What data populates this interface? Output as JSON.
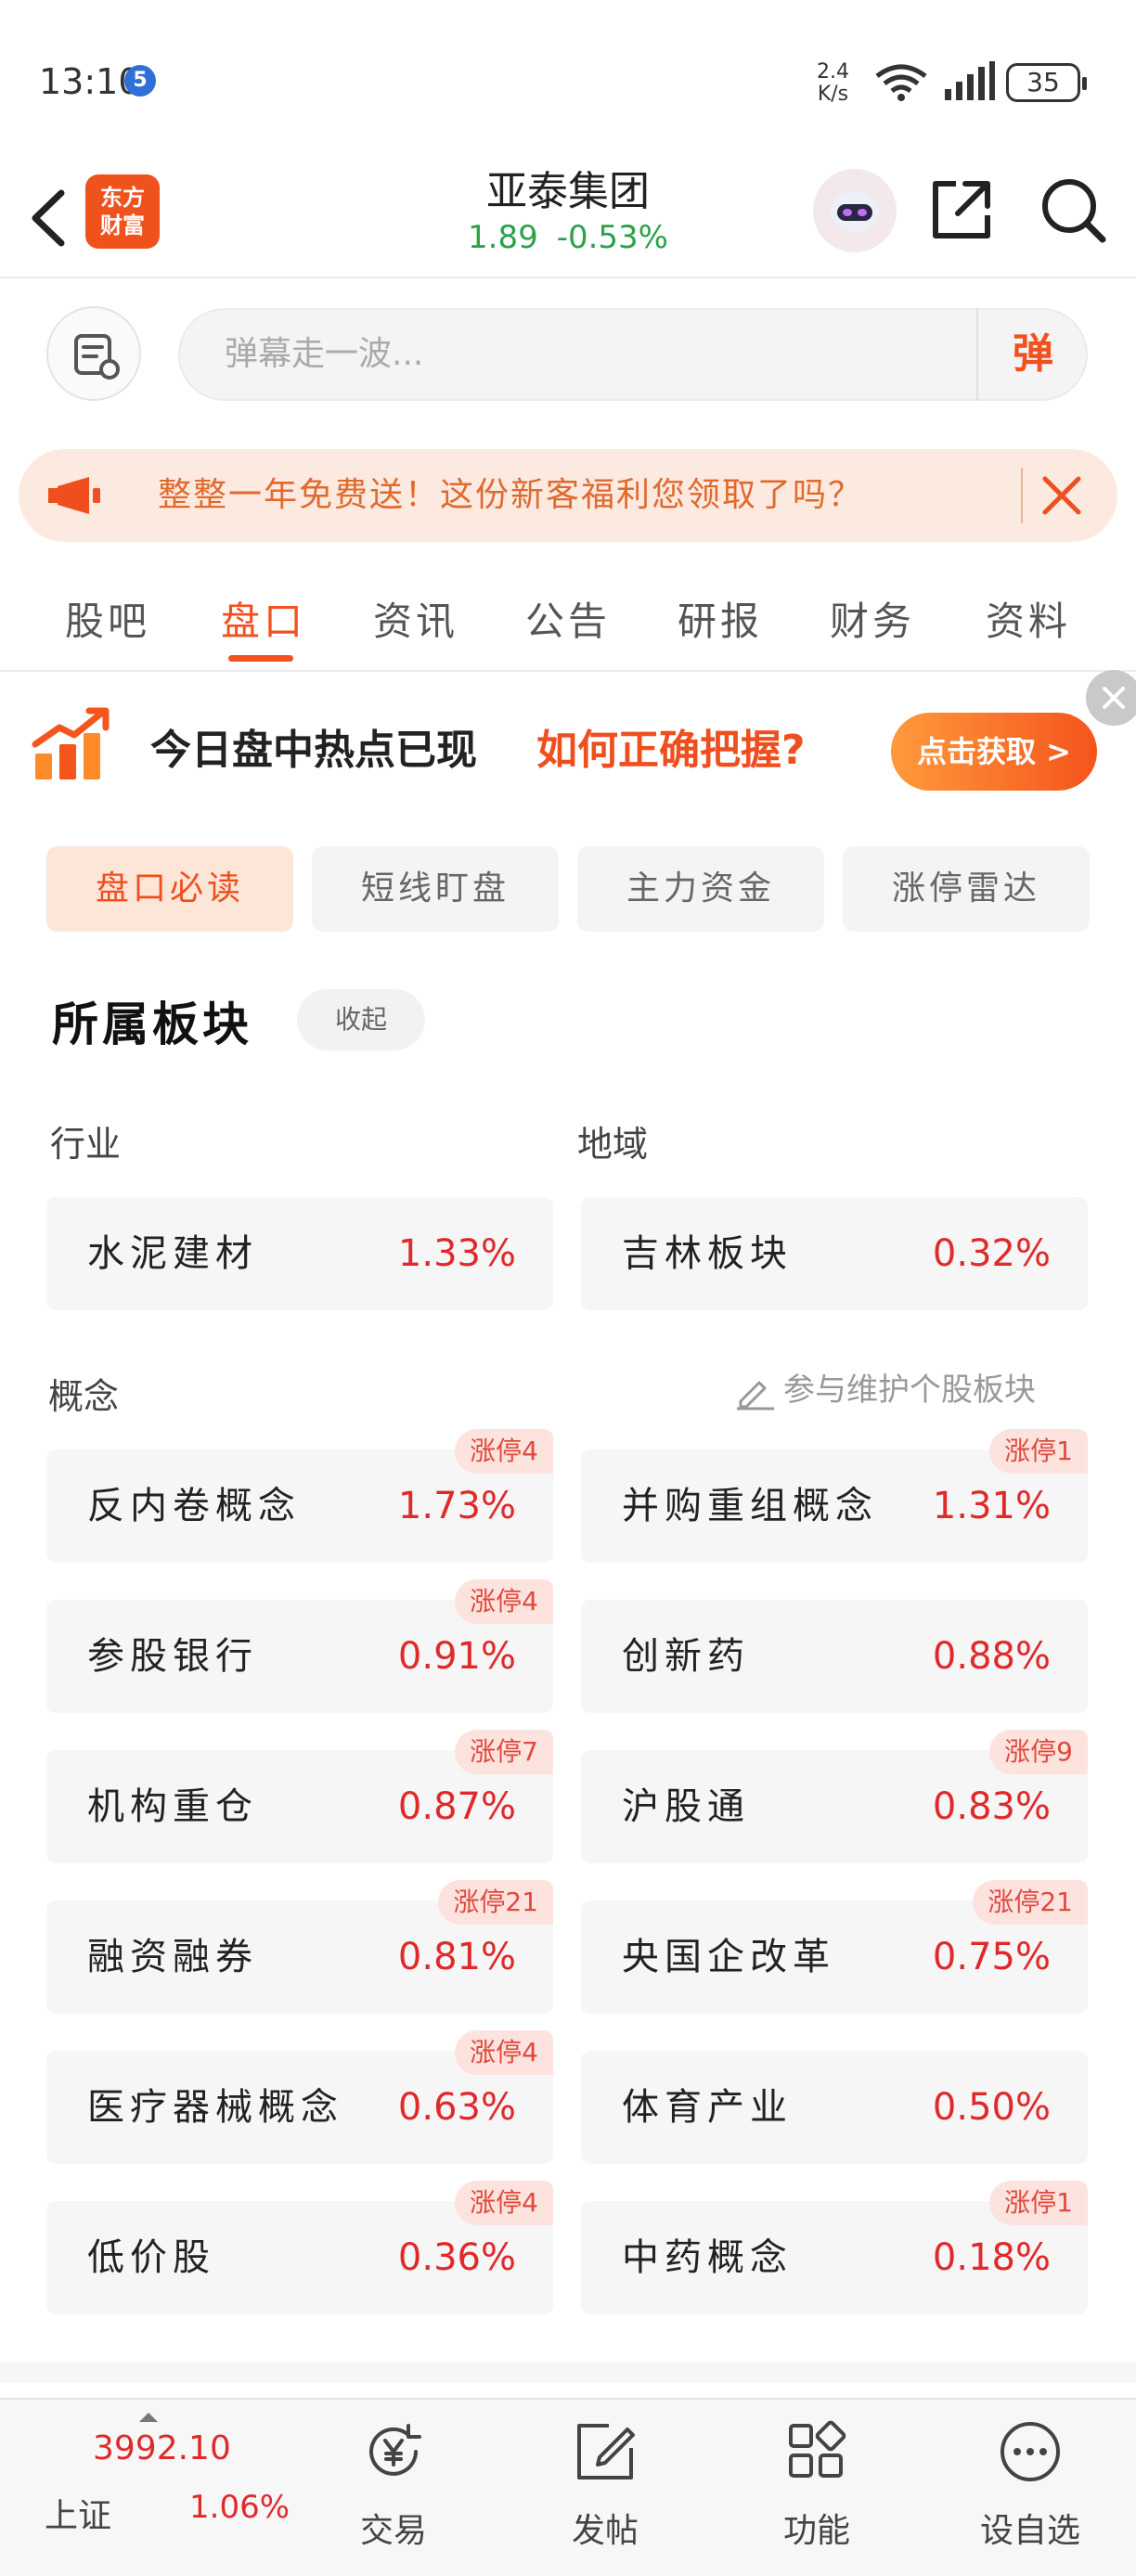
{
  "status_bar": {
    "time": "13:10",
    "notif": "5",
    "speed_value": "2.4",
    "speed_unit": "K/s",
    "battery": "35"
  },
  "header": {
    "logo_line1": "东方",
    "logo_line2": "财富",
    "stock_name": "亚泰集团",
    "price": "1.89",
    "change": "-0.53%"
  },
  "danmu": {
    "placeholder": "弹幕走一波...",
    "send_label": "弹"
  },
  "promo": {
    "text": "整整一年免费送！这份新客福利您领取了吗？"
  },
  "tabs": [
    "股吧",
    "盘口",
    "资讯",
    "公告",
    "研报",
    "财务",
    "资料"
  ],
  "active_tab": "盘口",
  "ad": {
    "text_black": "今日盘中热点已现",
    "text_orange": "如何正确把握?",
    "button": "点击获取 >"
  },
  "subtabs": [
    "盘口必读",
    "短线盯盘",
    "主力资金",
    "涨停雷达"
  ],
  "section": {
    "title": "所属板块",
    "collapse": "收起",
    "industry_label": "行业",
    "region_label": "地域",
    "concept_label": "概念",
    "maintain_link": "参与维护个股板块"
  },
  "industry": {
    "name": "水泥建材",
    "pct": "1.33%"
  },
  "region": {
    "name": "吉林板块",
    "pct": "0.32%"
  },
  "concepts": [
    {
      "name": "反内卷概念",
      "pct": "1.73%",
      "badge": "涨停4"
    },
    {
      "name": "并购重组概念",
      "pct": "1.31%",
      "badge": "涨停1"
    },
    {
      "name": "参股银行",
      "pct": "0.91%",
      "badge": "涨停4"
    },
    {
      "name": "创新药",
      "pct": "0.88%",
      "badge": ""
    },
    {
      "name": "机构重仓",
      "pct": "0.87%",
      "badge": "涨停7"
    },
    {
      "name": "沪股通",
      "pct": "0.83%",
      "badge": "涨停9"
    },
    {
      "name": "融资融券",
      "pct": "0.81%",
      "badge": "涨停21"
    },
    {
      "name": "央国企改革",
      "pct": "0.75%",
      "badge": "涨停21"
    },
    {
      "name": "医疗器械概念",
      "pct": "0.63%",
      "badge": "涨停4"
    },
    {
      "name": "体育产业",
      "pct": "0.50%",
      "badge": ""
    },
    {
      "name": "低价股",
      "pct": "0.36%",
      "badge": "涨停4"
    },
    {
      "name": "中药概念",
      "pct": "0.18%",
      "badge": "涨停1"
    }
  ],
  "bottom_nav": {
    "index_value": "3992.10",
    "index_name": "上证",
    "index_pct": "1.06%",
    "items": [
      "交易",
      "发帖",
      "功能",
      "设自选"
    ]
  },
  "colors": {
    "brand": "#f0521e",
    "up": "#e02a2a",
    "down": "#2aa24a"
  }
}
